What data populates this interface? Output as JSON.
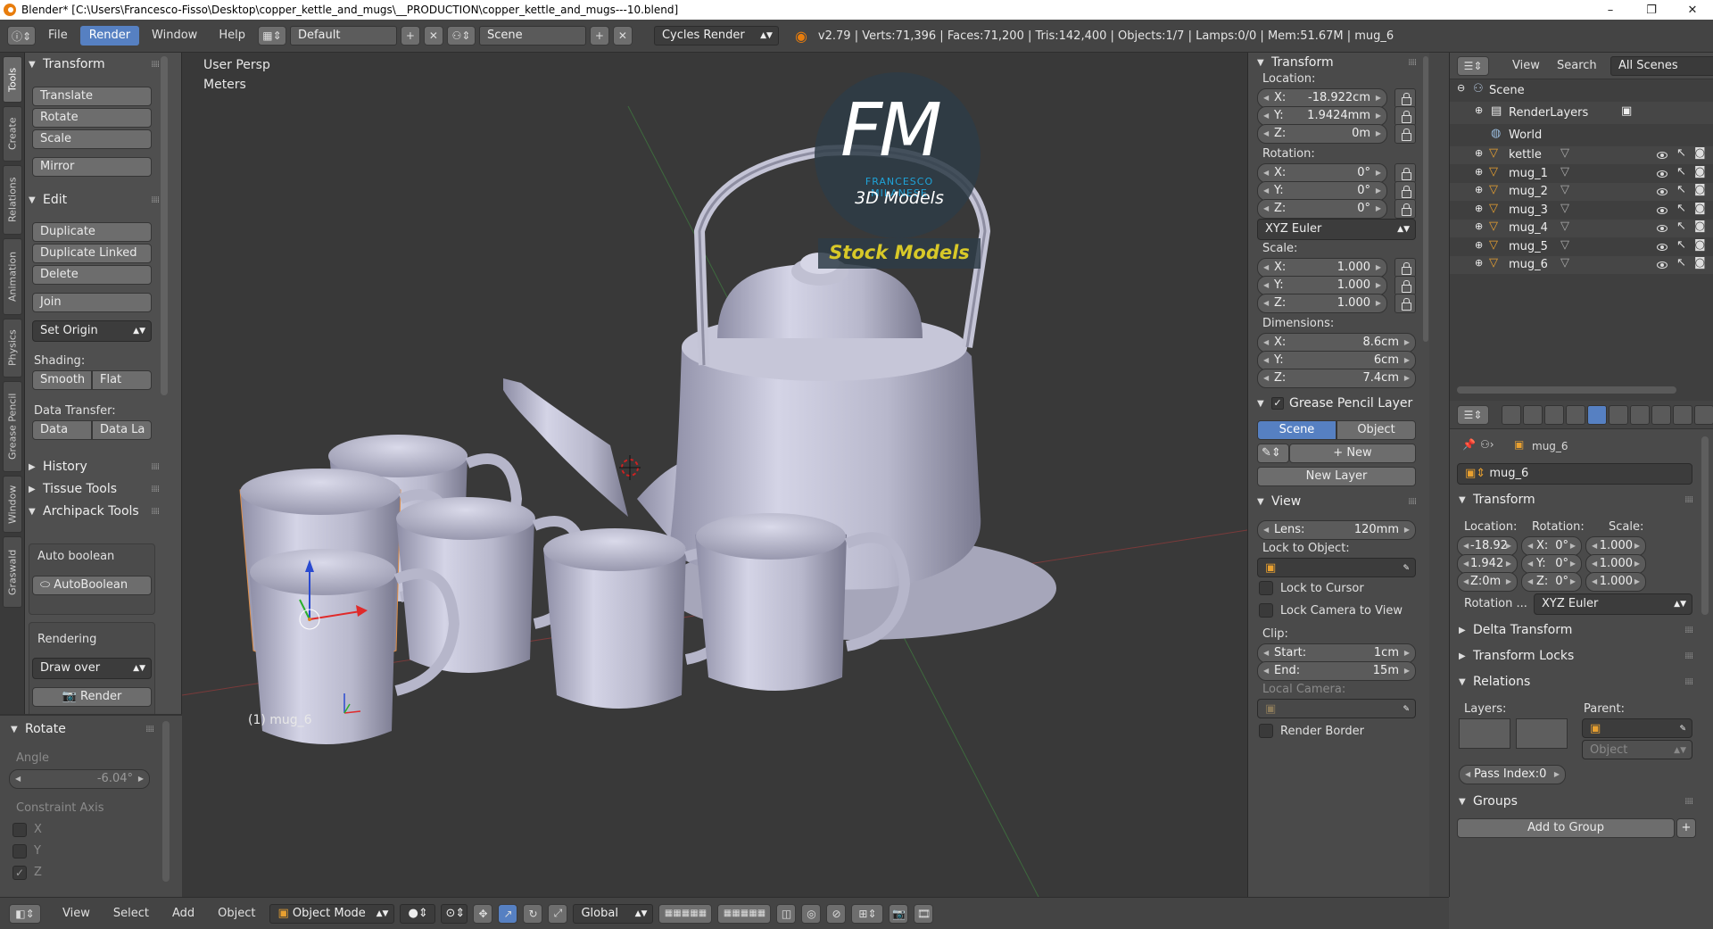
{
  "window": {
    "title": "Blender* [C:\\Users\\Francesco-Fisso\\Desktop\\copper_kettle_and_mugs\\__PRODUCTION\\copper_kettle_and_mugs---10.blend]",
    "minimize": "–",
    "maximize": "❐",
    "close": "✕"
  },
  "info_header": {
    "menus": [
      "File",
      "Render",
      "Window",
      "Help"
    ],
    "active_menu": "Render",
    "layout": "Default",
    "scene": "Scene",
    "engine": "Cycles Render",
    "stats": "v2.79 | Verts:71,396 | Faces:71,200 | Tris:142,400 | Objects:1/7 | Lamps:0/0 | Mem:51.67M | mug_6"
  },
  "tool_tabs": [
    "Tools",
    "Create",
    "Relations",
    "Animation",
    "Physics",
    "Grease Pencil",
    "Window",
    "Graswald"
  ],
  "tool_shelf": {
    "transform_header": "Transform",
    "transform_buttons": [
      "Translate",
      "Rotate",
      "Scale",
      "Mirror"
    ],
    "edit_header": "Edit",
    "edit_buttons": [
      "Duplicate",
      "Duplicate Linked",
      "Delete",
      "Join"
    ],
    "set_origin": "Set Origin",
    "shading_label": "Shading:",
    "smooth": "Smooth",
    "flat": "Flat",
    "data_transfer_label": "Data Transfer:",
    "data": "Data",
    "data_layout": "Data La",
    "history": "History",
    "tissue_tools": "Tissue Tools",
    "archipack": "Archipack Tools",
    "auto_boolean": "Auto boolean",
    "auto_boolean_btn": "AutoBoolean",
    "rendering_label": "Rendering",
    "draw_over": "Draw over",
    "render_btn": "Render"
  },
  "operator_panel": {
    "header": "Rotate",
    "angle_label": "Angle",
    "angle_value": "-6.04°",
    "constraint_label": "Constraint Axis",
    "axes": [
      "X",
      "Y",
      "Z"
    ],
    "z_checked": true
  },
  "viewport": {
    "view_name": "User Persp",
    "units": "Meters",
    "selected_label": "(1) mug_6",
    "watermark_fm": "FM",
    "watermark_name": "FRANCESCO MILANESE",
    "watermark_sub": "3D Models",
    "watermark_stock": "Stock Models"
  },
  "n_panel": {
    "transform_header": "Transform",
    "location_label": "Location:",
    "location": [
      {
        "k": "X:",
        "v": "-18.922cm"
      },
      {
        "k": "Y:",
        "v": "1.9424mm"
      },
      {
        "k": "Z:",
        "v": "0m"
      }
    ],
    "rotation_label": "Rotation:",
    "rotation": [
      {
        "k": "X:",
        "v": "0°"
      },
      {
        "k": "Y:",
        "v": "0°"
      },
      {
        "k": "Z:",
        "v": "0°"
      }
    ],
    "rotation_mode": "XYZ Euler",
    "scale_label": "Scale:",
    "scale": [
      {
        "k": "X:",
        "v": "1.000"
      },
      {
        "k": "Y:",
        "v": "1.000"
      },
      {
        "k": "Z:",
        "v": "1.000"
      }
    ],
    "dimensions_label": "Dimensions:",
    "dimensions": [
      {
        "k": "X:",
        "v": "8.6cm"
      },
      {
        "k": "Y:",
        "v": "6cm"
      },
      {
        "k": "Z:",
        "v": "7.4cm"
      }
    ],
    "grease_header": "Grease Pencil Layer",
    "scene_tab": "Scene",
    "object_tab": "Object",
    "new": "New",
    "new_layer": "New Layer",
    "view_header": "View",
    "lens": "Lens:",
    "lens_value": "120mm",
    "lock_object": "Lock to Object:",
    "lock_cursor": "Lock to Cursor",
    "lock_camera": "Lock Camera to View",
    "clip_label": "Clip:",
    "clip_start": "Start:",
    "clip_start_value": "1cm",
    "clip_end": "End:",
    "clip_end_value": "15m",
    "local_camera": "Local Camera:",
    "render_border": "Render Border"
  },
  "outliner": {
    "view": "View",
    "search": "Search",
    "scope": "All Scenes",
    "scene": "Scene",
    "render_layers": "RenderLayers",
    "world": "World",
    "objects": [
      "kettle",
      "mug_1",
      "mug_2",
      "mug_3",
      "mug_4",
      "mug_5",
      "mug_6"
    ]
  },
  "properties": {
    "object_name_crumb": "mug_6",
    "object_name": "mug_6",
    "transform_header": "Transform",
    "location_label": "Location:",
    "rotation_label": "Rotation:",
    "scale_label": "Scale:",
    "loc": [
      "-18.92",
      "1.942",
      "Z:0m"
    ],
    "rot": [
      {
        "k": "X:",
        "v": "0°"
      },
      {
        "k": "Y:",
        "v": "0°"
      },
      {
        "k": "Z:",
        "v": "0°"
      }
    ],
    "scl": [
      "1.000",
      "1.000",
      "1.000"
    ],
    "rotation_mode_label": "Rotation ...",
    "rotation_mode": "XYZ Euler",
    "delta_transform": "Delta Transform",
    "transform_locks": "Transform Locks",
    "relations": "Relations",
    "layers_label": "Layers:",
    "parent_label": "Parent:",
    "parent_type": "Object",
    "pass_index": "Pass Index:0",
    "groups": "Groups",
    "add_to_group": "Add to Group"
  },
  "bottom_bar": {
    "menus": [
      "View",
      "Select",
      "Add",
      "Object"
    ],
    "mode": "Object Mode",
    "orientation": "Global"
  }
}
